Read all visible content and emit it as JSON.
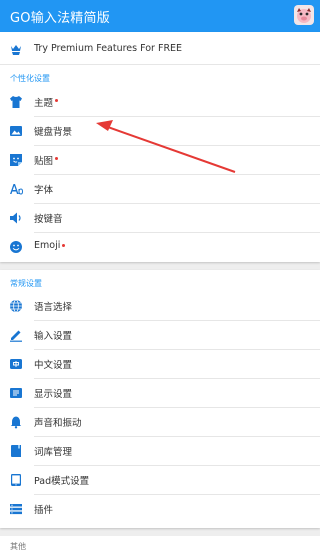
{
  "app": {
    "title": "GO输入法精简版",
    "avatar_icon": "pig-avatar-icon"
  },
  "premium": {
    "label": "Try Premium Features For FREE",
    "icon": "crown-hand-icon"
  },
  "personalization": {
    "header": "个性化设置",
    "items": [
      {
        "label": "主题",
        "icon": "shirt-icon",
        "dot": true
      },
      {
        "label": "键盘背景",
        "icon": "image-icon",
        "dot": false
      },
      {
        "label": "贴图",
        "icon": "sticker-icon",
        "dot": true
      },
      {
        "label": "字体",
        "icon": "font-icon",
        "dot": false
      },
      {
        "label": "按键音",
        "icon": "speaker-icon",
        "dot": false
      },
      {
        "label": "Emoji",
        "icon": "smiley-icon",
        "dot": true
      }
    ]
  },
  "general": {
    "header": "常规设置",
    "items": [
      {
        "label": "语言选择",
        "icon": "globe-icon"
      },
      {
        "label": "输入设置",
        "icon": "pencil-icon"
      },
      {
        "label": "中文设置",
        "icon": "chinese-keyboard-icon"
      },
      {
        "label": "显示设置",
        "icon": "display-icon"
      },
      {
        "label": "声音和振动",
        "icon": "bell-icon"
      },
      {
        "label": "词库管理",
        "icon": "book-icon"
      },
      {
        "label": "Pad模式设置",
        "icon": "tablet-icon"
      },
      {
        "label": "插件",
        "icon": "plugin-icon"
      }
    ]
  },
  "other": {
    "header": "其他"
  },
  "colors": {
    "appbar": "#2196f3",
    "icon": "#1976d2",
    "badge_dot": "#e53935",
    "arrow": "#e53935"
  }
}
